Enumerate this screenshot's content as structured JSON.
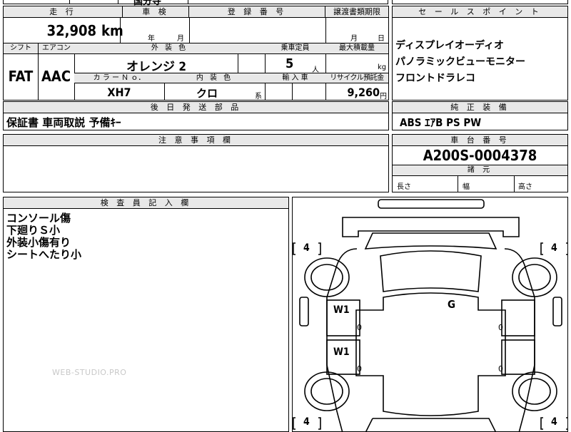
{
  "top_strip": {
    "fragment": "国分寺"
  },
  "vehicle": {
    "mileage_label": "走 行",
    "mileage_value": "32,908",
    "mileage_unit": "km",
    "inspection_label": "車 検",
    "inspection_year_unit": "年",
    "inspection_month_unit": "月",
    "registration_label": "登 録 番 号",
    "transfer_label": "譲渡書類期限",
    "transfer_month_unit": "月",
    "transfer_day_unit": "日",
    "shift_label": "シフト",
    "shift_value": "FAT",
    "aircon_label": "エアコン",
    "aircon_value": "AAC",
    "exterior_label": "外 装 色",
    "exterior_value": "オレンジ 2",
    "capacity_label": "乗車定員",
    "capacity_value": "5",
    "capacity_unit": "人",
    "load_label": "最大積載量",
    "load_unit": "kg",
    "color_no_label": "カ ラ ー Ｎ ｏ．",
    "color_no_value": "XH7",
    "interior_label": "内 装 色",
    "interior_value": "クロ",
    "interior_suffix": "系",
    "import_label": "輸 入 車",
    "recycle_label": "リサイクル預託金",
    "recycle_value": "9,260",
    "recycle_unit": "円"
  },
  "sales_points": {
    "label": "セ ー ル ス ポ イ ン ト",
    "items": [
      "ディスプレイオーディオ",
      "パノラミックビューモニター",
      "フロントドラレコ"
    ]
  },
  "parts": {
    "label": "後 日 発 送 部 品",
    "value": "保証書 車両取説 予備ｷｰ"
  },
  "equipment": {
    "label": "純 正 装 備",
    "value": "ABS ｴｱB PS PW"
  },
  "notes": {
    "label": "注 意 事 項 欄"
  },
  "chassis": {
    "label": "車 台 番 号",
    "value": "A200S-0004378"
  },
  "dimensions": {
    "label": "諸 元",
    "length": "長さ",
    "width": "幅",
    "height": "高さ"
  },
  "inspector": {
    "label": "検 査 員 記 入 欄",
    "lines": [
      "コンソール傷",
      "下廻りＳ小",
      "外装小傷有り",
      "シートへたり小"
    ]
  },
  "watermark": "WEB-STUDIO.PRO",
  "diagram": {
    "tire_front_left": "4",
    "tire_front_right": "4",
    "tire_rear_left": "4",
    "tire_rear_right": "4",
    "window_front": "W1",
    "window_front_val": "0",
    "window_rear": "W1",
    "window_rear_val": "0",
    "roof_mark": "G",
    "side_right_front_val": "0",
    "side_right_rear_val": "0"
  }
}
